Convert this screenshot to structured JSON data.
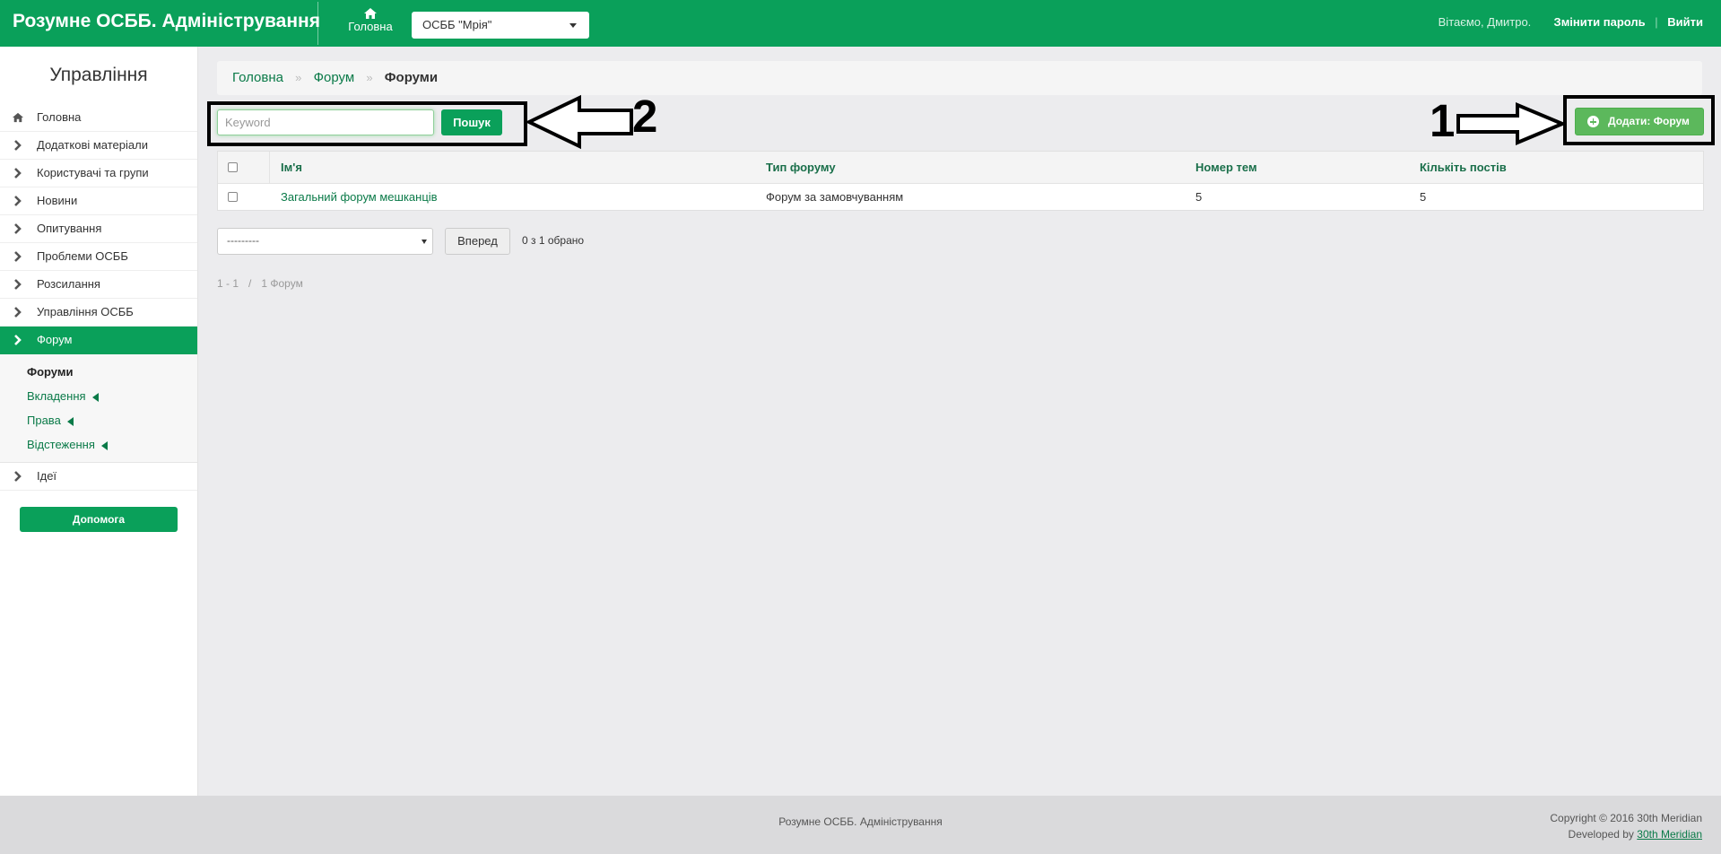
{
  "header": {
    "brand": "Розумне ОСББ. Адміністрування",
    "home_label": "Головна",
    "osbb_selected": "ОСББ \"Мрія\"",
    "greeting": "Вітаємо, Дмитро.",
    "change_password": "Змінити пароль",
    "separator": "|",
    "logout": "Вийти"
  },
  "sidebar": {
    "title": "Управління",
    "items": [
      {
        "label": "Головна",
        "icon": "home-icon"
      },
      {
        "label": "Додаткові матеріали",
        "icon": "chevron-right-icon"
      },
      {
        "label": "Користувачі та групи",
        "icon": "chevron-right-icon"
      },
      {
        "label": "Новини",
        "icon": "chevron-right-icon"
      },
      {
        "label": "Опитування",
        "icon": "chevron-right-icon"
      },
      {
        "label": "Проблеми ОСББ",
        "icon": "chevron-right-icon"
      },
      {
        "label": "Розсилання",
        "icon": "chevron-right-icon"
      },
      {
        "label": "Управління ОСББ",
        "icon": "chevron-right-icon"
      },
      {
        "label": "Форум",
        "icon": "chevron-right-icon",
        "active": true
      },
      {
        "label": "Ідеї",
        "icon": "chevron-right-icon"
      }
    ],
    "submenu": [
      {
        "label": "Форуми",
        "current": true
      },
      {
        "label": "Вкладення"
      },
      {
        "label": "Права"
      },
      {
        "label": "Відстеження"
      }
    ],
    "help_button": "Допомога"
  },
  "breadcrumb": {
    "items": [
      "Головна",
      "Форум",
      "Форуми"
    ],
    "separator": "»"
  },
  "search": {
    "placeholder": "Keyword",
    "value": "",
    "button": "Пошук"
  },
  "annotations": {
    "label_1": "1",
    "label_2": "2"
  },
  "add_button": "Додати: Форум",
  "table": {
    "columns": [
      "Ім'я",
      "Тип форуму",
      "Номер тем",
      "Кількіть постів"
    ],
    "rows": [
      {
        "name": "Загальний форум мешканців",
        "type": "Форум за замовчуванням",
        "topics": "5",
        "posts": "5"
      }
    ]
  },
  "actions": {
    "select_value": "---------",
    "go_button": "Вперед",
    "selected_count": "0 з 1 обрано"
  },
  "pagination": {
    "range": "1 - 1",
    "slash": "/",
    "total": "1 Форум"
  },
  "footer": {
    "center": "Розумне ОСББ. Адміністрування",
    "copyright": "Copyright © 2016 30th Meridian",
    "developed_by": "Developed by",
    "developer_link": "30th Meridian"
  },
  "colors": {
    "brand_green": "#0aa05a",
    "add_button_green": "#5cb85c",
    "link_green": "#0a7a48"
  }
}
